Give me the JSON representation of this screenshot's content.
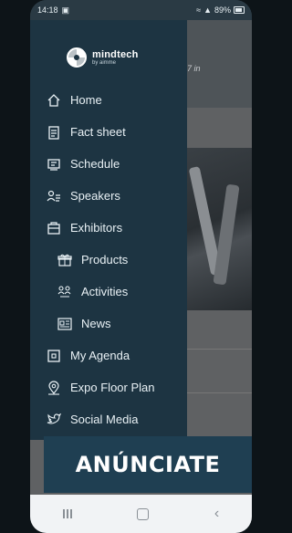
{
  "status_bar": {
    "time": "14:18",
    "battery": "89%"
  },
  "background": {
    "snippet": "7 in"
  },
  "brand": {
    "name": "mindtech",
    "sub": "by aimme"
  },
  "menu": [
    {
      "label": "Home",
      "icon": "home-icon"
    },
    {
      "label": "Fact sheet",
      "icon": "document-icon"
    },
    {
      "label": "Schedule",
      "icon": "schedule-icon"
    },
    {
      "label": "Speakers",
      "icon": "speakers-icon"
    },
    {
      "label": "Exhibitors",
      "icon": "exhibitors-icon"
    },
    {
      "label": "Products",
      "icon": "gift-box-icon"
    },
    {
      "label": "Activities",
      "icon": "activities-icon"
    },
    {
      "label": "News",
      "icon": "newspaper-icon"
    },
    {
      "label": "My Agenda",
      "icon": "agenda-icon"
    },
    {
      "label": "Expo Floor Plan",
      "icon": "location-pin-icon"
    },
    {
      "label": "Social Media",
      "icon": "bird-icon"
    }
  ],
  "banner": {
    "label": "ANÚNCIATE"
  },
  "colors": {
    "drawer": "#1d3442",
    "banner": "#1f3f52"
  }
}
